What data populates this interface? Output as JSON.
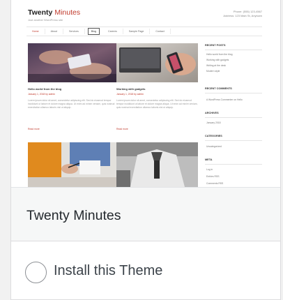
{
  "preview": {
    "logo_main": "Twenty",
    "logo_accent": "Minutes",
    "tagline": "Just another WordPress site",
    "contact_line1": "Phone: (555) 123-4567",
    "contact_line2": "Address: 123 Main St, Anytown",
    "nav": [
      "Home",
      "About",
      "Services",
      "Blog",
      "Careers",
      "Sample Page",
      "Contact"
    ],
    "posts": [
      {
        "title": "Hello world from the blog",
        "meta": "January 1, 2018 by admin",
        "body": "Lorem ipsum dolor sit amet, consectetur adipiscing elit. Sed do eiusmod tempor incididunt ut labore et dolore magna aliqua. Ut enim ad minim veniam, quis nostrud exercitation ullamco laboris nisi ut aliquip.",
        "more": "Read more"
      },
      {
        "title": "Working with gadgets",
        "meta": "January 1, 2018 by admin",
        "body": "Lorem ipsum dolor sit amet, consectetur adipiscing elit. Sed do eiusmod tempor incididunt ut labore et dolore magna aliqua. Ut enim ad minim veniam, quis nostrud exercitation ullamco laboris nisi ut aliquip.",
        "more": "Read more"
      }
    ],
    "sidebar": {
      "recent_posts_title": "RECENT POSTS",
      "recent_posts": [
        "Hello world from the blog",
        "Working with gadgets",
        "Writing at the desk",
        "Modern style"
      ],
      "recent_comments_title": "RECENT COMMENTS",
      "recent_comment": "A WordPress Commenter on Hello",
      "archives_title": "ARCHIVES",
      "archive_item": "January 2018",
      "categories_title": "CATEGORIES",
      "category_item": "Uncategorized",
      "meta_title": "META",
      "meta_items": [
        "Log in",
        "Entries RSS",
        "Comments RSS"
      ]
    }
  },
  "theme": {
    "name": "Twenty Minutes"
  },
  "install": {
    "label": "Install this Theme"
  },
  "colors": {
    "accent": "#c0392b",
    "footer_bg": "#f6f7f7",
    "radio_border": "#8c8f94"
  }
}
